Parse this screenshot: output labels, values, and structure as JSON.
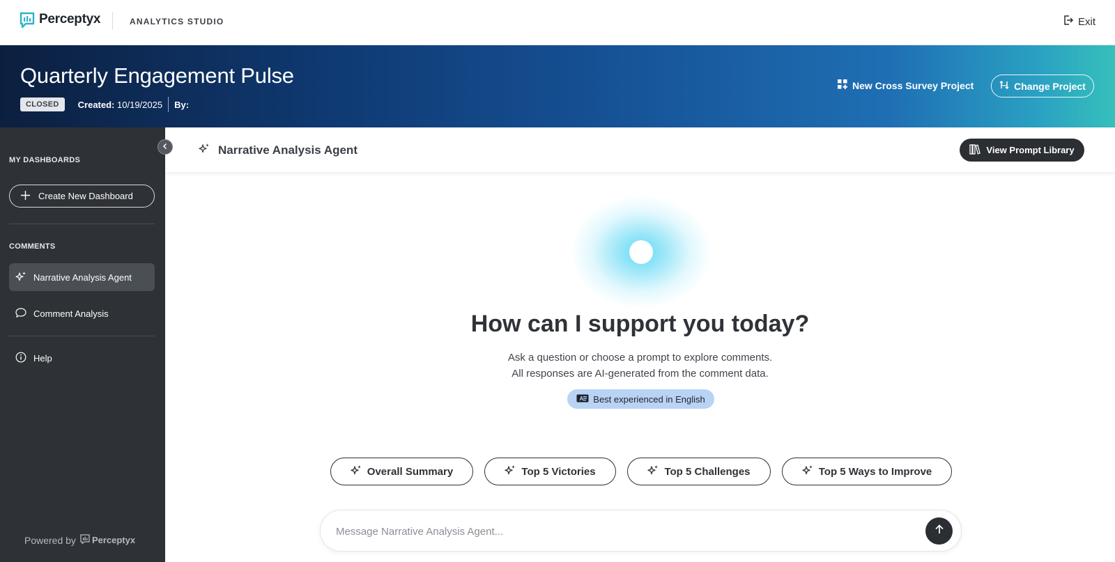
{
  "topbar": {
    "brand_name": "Perceptyx",
    "studio_label": "ANALYTICS STUDIO",
    "exit_label": "Exit"
  },
  "project": {
    "title": "Quarterly Engagement Pulse",
    "status": "CLOSED",
    "created_label": "Created:",
    "created_value": "10/19/2025",
    "by_label": "By:",
    "new_cross_survey_label": "New Cross Survey Project",
    "change_project_label": "Change Project"
  },
  "sidebar": {
    "dashboards_heading": "MY DASHBOARDS",
    "create_dashboard_label": "Create New Dashboard",
    "comments_heading": "COMMENTS",
    "items": [
      {
        "label": "Narrative Analysis Agent",
        "icon": "sparkles-icon",
        "active": true
      },
      {
        "label": "Comment Analysis",
        "icon": "chat-bubble-icon",
        "active": false
      }
    ],
    "help_label": "Help",
    "powered_by_label": "Powered by",
    "powered_brand": "Perceptyx"
  },
  "main": {
    "agent_title": "Narrative Analysis Agent",
    "library_label": "View Prompt Library",
    "greeting": "How can I support you today?",
    "sub_line_1": "Ask a question or choose a prompt to explore comments.",
    "sub_line_2": "All responses are AI-generated from the comment data.",
    "language_note": "Best experienced in English",
    "prompts": [
      {
        "label": "Overall Summary"
      },
      {
        "label": "Top 5 Victories"
      },
      {
        "label": "Top 5 Challenges"
      },
      {
        "label": "Top 5 Ways to Improve"
      }
    ],
    "composer_placeholder": "Message Narrative Analysis Agent..."
  },
  "colors": {
    "brand_teal": "#2bb3c9",
    "sidebar_bg": "#2e3136",
    "sidebar_active": "#4a4e55",
    "dark_button": "#2b2e33",
    "language_pill": "#b9d3f5",
    "orb_glow": "#5ad7f5"
  }
}
